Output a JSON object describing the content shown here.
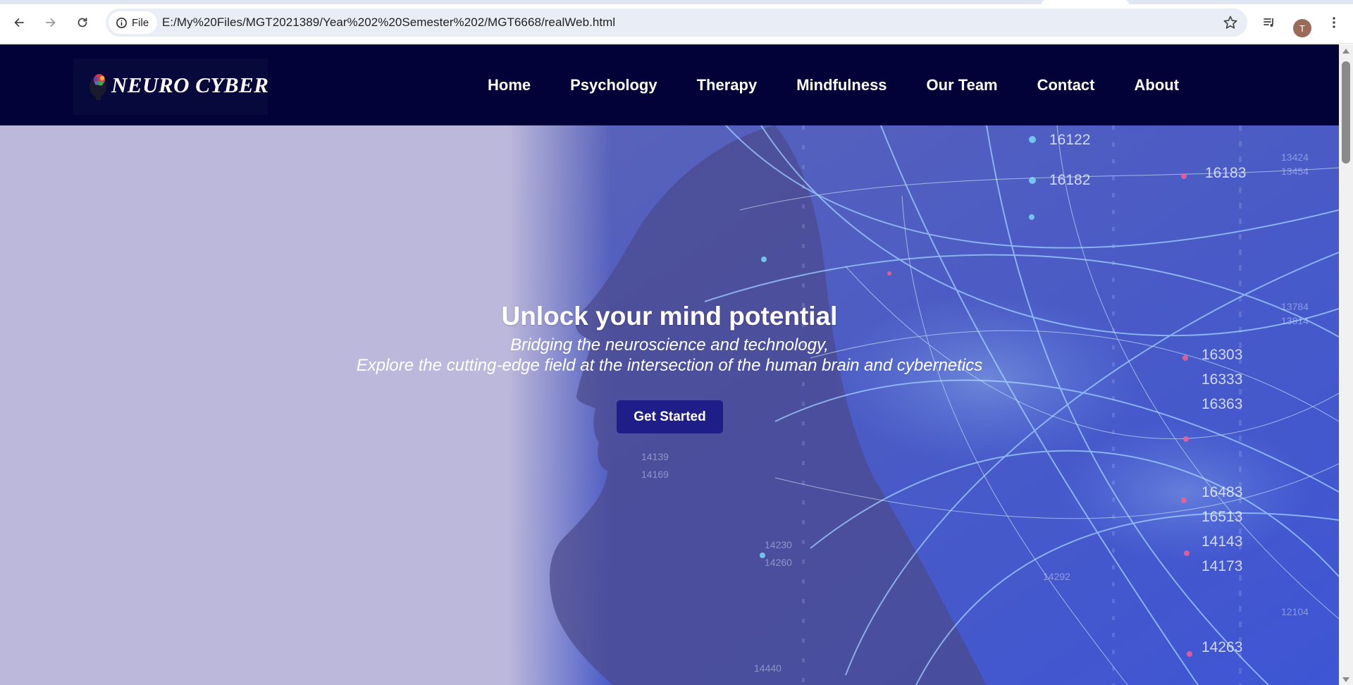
{
  "browser": {
    "url": "E:/My%20Files/MGT2021389/Year%202%20Semester%202/MGT6668/realWeb.html",
    "site_chip_label": "File",
    "profile_initial": "T",
    "icons": [
      "back-icon",
      "forward-icon",
      "reload-icon",
      "info-icon",
      "star-icon",
      "media-controls-icon",
      "avatar",
      "kebab-menu-icon"
    ]
  },
  "site": {
    "logo_text": "NEURO CYBER",
    "nav": [
      "Home",
      "Psychology",
      "Therapy",
      "Mindfulness",
      "Our Team",
      "Contact",
      "About"
    ]
  },
  "hero": {
    "title": "Unlock your mind potential",
    "subtitle_line1": "Bridging the neuroscience and technology,",
    "subtitle_line2": "Explore the cutting-edge field at the intersection of the human brain and cybernetics",
    "cta_label": "Get Started",
    "numbers": [
      "16122",
      "16182",
      "16183",
      "16303",
      "16333",
      "16363",
      "16483",
      "16513",
      "14143",
      "14173",
      "14263",
      "14230",
      "14260",
      "14292",
      "14139",
      "14169",
      "13424",
      "13454",
      "13784",
      "13814",
      "12104",
      "14440"
    ]
  },
  "colors": {
    "navbar_bg": "#020238",
    "hero_bg": "#bcb8db",
    "cta_bg": "#1f1d88",
    "accent_blue": "#4f7dff"
  }
}
